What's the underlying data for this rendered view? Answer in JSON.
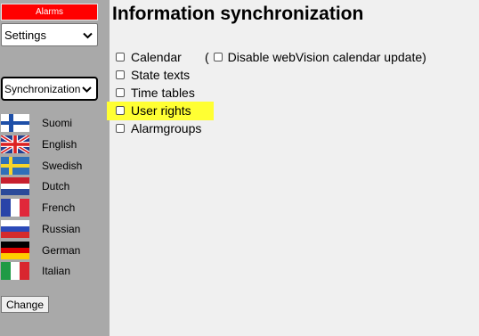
{
  "sidebar": {
    "alarms_label": "Alarms",
    "settings_select": {
      "value": "Settings"
    },
    "sync_select": {
      "value": "Synchronization"
    },
    "languages": [
      {
        "label": "Suomi",
        "flag": "finland-flag"
      },
      {
        "label": "English",
        "flag": "uk-flag"
      },
      {
        "label": "Swedish",
        "flag": "sweden-flag"
      },
      {
        "label": "Dutch",
        "flag": "netherlands-flag"
      },
      {
        "label": "French",
        "flag": "france-flag"
      },
      {
        "label": "Russian",
        "flag": "russia-flag"
      },
      {
        "label": "German",
        "flag": "germany-flag"
      },
      {
        "label": "Italian",
        "flag": "italy-flag"
      }
    ],
    "change_label": "Change"
  },
  "main": {
    "title": "Information synchronization",
    "options": [
      {
        "label": "Calendar",
        "checked": false
      },
      {
        "label": "State texts",
        "checked": false
      },
      {
        "label": "Time tables",
        "checked": false
      },
      {
        "label": "User rights",
        "checked": false,
        "highlighted": true
      },
      {
        "label": "Alarmgroups",
        "checked": false
      }
    ],
    "calendar_extra": {
      "open_paren": "(",
      "label": "Disable webVision calendar update)",
      "checked": false
    }
  },
  "colors": {
    "sidebar_bg": "#a9a9a9",
    "alarms_bg": "#ff0000",
    "highlight": "#ffff33"
  }
}
